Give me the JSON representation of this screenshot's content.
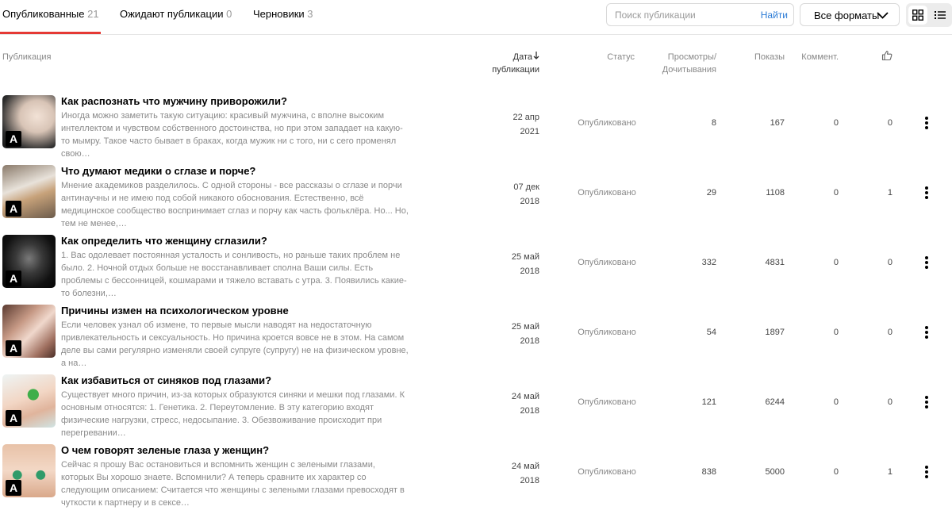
{
  "tabs": [
    {
      "label": "Опубликованные",
      "count": "21"
    },
    {
      "label": "Ожидают публикации",
      "count": "0"
    },
    {
      "label": "Черновики",
      "count": "3"
    }
  ],
  "search": {
    "placeholder": "Поиск публикации",
    "button": "Найти",
    "value": ""
  },
  "format_select": {
    "label": "Все форматы"
  },
  "view_toggle": {
    "grid_icon": "grid-icon",
    "list_icon": "list-icon"
  },
  "columns": {
    "publication": "Публикация",
    "date_line1": "Дата",
    "date_line2": "публикации",
    "status": "Статус",
    "views_line1": "Просмотры/",
    "views_line2": "Дочитывания",
    "shows": "Показы",
    "comments": "Коммент.",
    "likes_icon": "thumbs-up-icon"
  },
  "rows": [
    {
      "title": "Как распознать что мужчину приворожили?",
      "excerpt": "Иногда можно заметить такую ситуацию: красивый мужчина, с вполне высоким интеллектом и чувством собственного достоинства, но при этом западает на какую-то мымру. Такое часто бывает в браках, когда мужик ни с того, ни с сего променял свою…",
      "date_day": "22 апр",
      "date_year": "2021",
      "status": "Опубликовано",
      "views": "8",
      "shows": "167",
      "comments": "0",
      "likes": "0",
      "badge": "A"
    },
    {
      "title": "Что думают медики о сглазе и порче?",
      "excerpt": "Мнение академиков разделилось. С одной стороны - все рассказы о сглазе и порчи антинаучны и не имею под собой никакого обоснования. Естественно, всё медицинское сообщество воспринимает сглаз и порчу как часть фольклёра. Но... Но, тем не менее,…",
      "date_day": "07 дек",
      "date_year": "2018",
      "status": "Опубликовано",
      "views": "29",
      "shows": "1108",
      "comments": "0",
      "likes": "1",
      "badge": "A"
    },
    {
      "title": "Как определить что женщину сглазили?",
      "excerpt": "1. Вас одолевает постоянная усталость и сонливость, но раньше таких проблем не было. 2. Ночной отдых больше не восстанавливает сполна Ваши силы. Есть проблемы с бессонницей, кошмарами и тяжело вставать с утра. 3. Появились какие-то болезни,…",
      "date_day": "25 май",
      "date_year": "2018",
      "status": "Опубликовано",
      "views": "332",
      "shows": "4831",
      "comments": "0",
      "likes": "0",
      "badge": "A"
    },
    {
      "title": "Причины измен на психологическом уровне",
      "excerpt": "Если человек узнал об измене, то первые мысли наводят на недостаточную привлекательность и сексуальность. Но причина кроется вовсе не в этом. На самом деле вы сами регулярно изменяли своей супруге (супругу) не на физическом уровне, а на…",
      "date_day": "25 май",
      "date_year": "2018",
      "status": "Опубликовано",
      "views": "54",
      "shows": "1897",
      "comments": "0",
      "likes": "0",
      "badge": "A"
    },
    {
      "title": "Как избавиться от синяков под глазами?",
      "excerpt": "Существует много причин, из-за которых образуются синяки и мешки под глазами. К основным относятся: 1. Генетика. 2. Переутомление. В эту категорию входят физические нагрузки, стресс, недосыпание. 3. Обезвоживание происходит при перегревании…",
      "date_day": "24 май",
      "date_year": "2018",
      "status": "Опубликовано",
      "views": "121",
      "shows": "6244",
      "comments": "0",
      "likes": "0",
      "badge": "A"
    },
    {
      "title": "О чем говорят зеленые глаза у женщин?",
      "excerpt": "Сейчас я прошу Вас остановиться и вспомнить женщин с зелеными глазами, которых Вы хорошо знаете. Вспомнили? А теперь сравните их характер со следующим описанием: Считается что женщины с зелеными глазами превосходят в чуткости к партнеру и в сексе…",
      "date_day": "24 май",
      "date_year": "2018",
      "status": "Опубликовано",
      "views": "838",
      "shows": "5000",
      "comments": "0",
      "likes": "1",
      "badge": "A"
    }
  ],
  "colors": {
    "accent": "#e53935",
    "link": "#2b7bd6"
  }
}
